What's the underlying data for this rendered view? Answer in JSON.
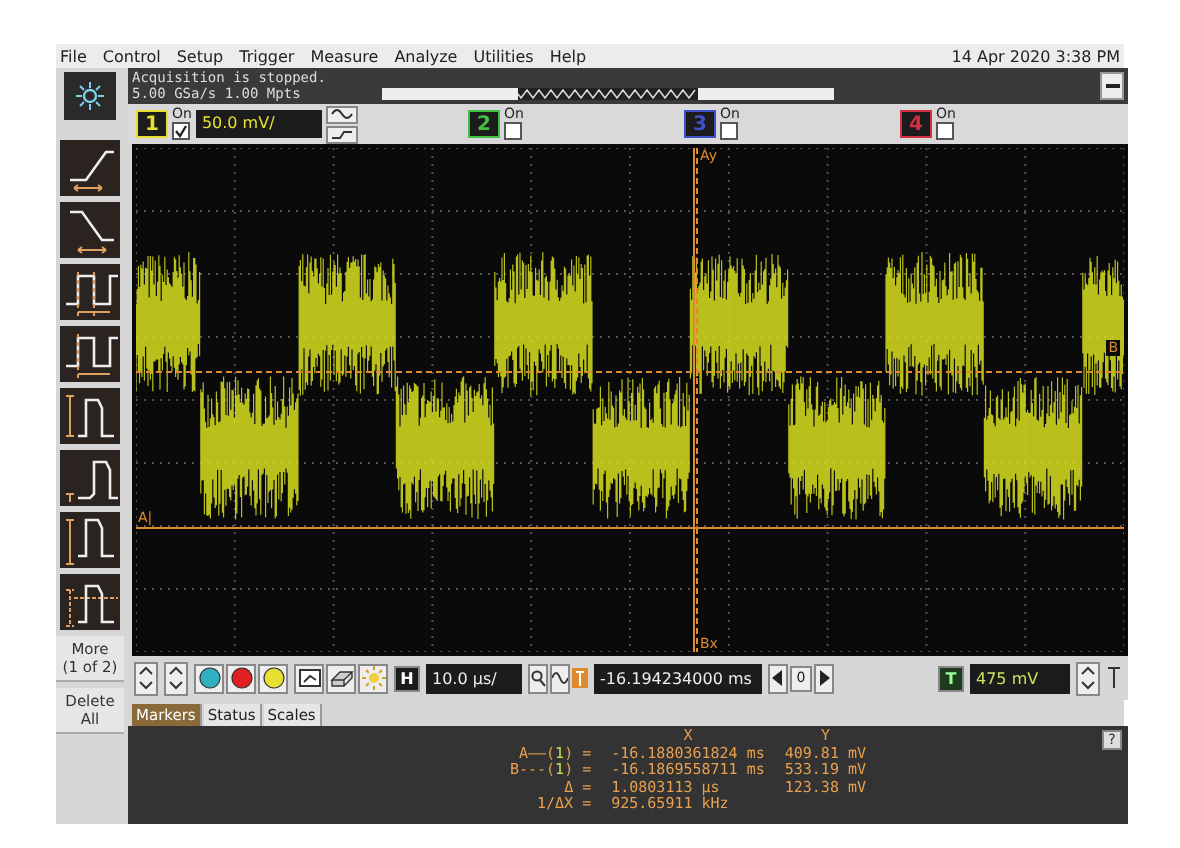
{
  "menu": [
    "File",
    "Control",
    "Setup",
    "Trigger",
    "Measure",
    "Analyze",
    "Utilities",
    "Help"
  ],
  "datetime": "14 Apr 2020  3:38 PM",
  "status": {
    "line_1": "Acquisition is stopped.",
    "line_2": "5.00 GSa/s  1.00 Mpts"
  },
  "channels": [
    {
      "number": "1",
      "on_label": "On",
      "checked": true,
      "color": "#e8e030",
      "scale": "50.0 mV/"
    },
    {
      "number": "2",
      "on_label": "On",
      "checked": false,
      "color": "#40c040"
    },
    {
      "number": "3",
      "on_label": "On",
      "checked": false,
      "color": "#4050c8"
    },
    {
      "number": "4",
      "on_label": "On",
      "checked": false,
      "color": "#d03040"
    }
  ],
  "graticule": {
    "marker_labels": {
      "top": "Ay",
      "bottom": "Bx",
      "left": "A|",
      "right": "B"
    }
  },
  "sidebar": {
    "buttons": [
      {
        "label": "More\n(1 of 2)"
      },
      {
        "label": "Delete\nAll"
      }
    ]
  },
  "toolbar": {
    "run_buttons": [
      {
        "color": "#30b0c0"
      },
      {
        "color": "#e02020"
      },
      {
        "color": "#e8e030"
      }
    ],
    "horizontal_label": "H",
    "horizontal_scale": "10.0 µs/",
    "delay": "-16.194234000 ms",
    "reference": "0",
    "trigger_label": "T",
    "trigger_level": "475 mV"
  },
  "tabs": [
    {
      "label": "Markers",
      "selected": true
    },
    {
      "label": "Status",
      "selected": false
    },
    {
      "label": "Scales",
      "selected": false
    }
  ],
  "markers": {
    "header_x": "X",
    "header_y": "Y",
    "help": "?",
    "rows": [
      {
        "prefix": "A——(",
        "channel": "1",
        "suffix": ") =",
        "x": "-16.1880361824 ms",
        "y": "409.81 mV"
      },
      {
        "prefix": "B---(",
        "channel": "1",
        "suffix": ") =",
        "x": "-16.1869558711 ms",
        "y": "533.19 mV"
      },
      {
        "prefix": "Δ =",
        "x": "1.0803113 µs",
        "y": "123.38 mV"
      },
      {
        "prefix": "1/ΔX =",
        "x": "925.65911 kHz"
      }
    ]
  }
}
